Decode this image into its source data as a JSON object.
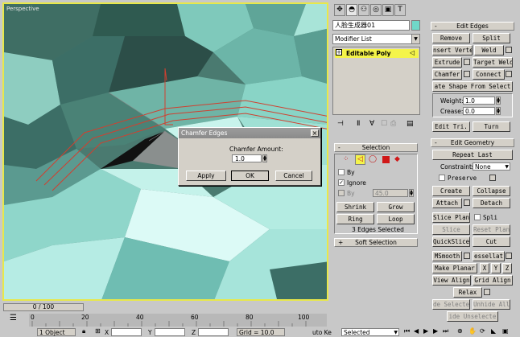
{
  "viewport": {
    "label": "Perspective"
  },
  "dialog": {
    "title": "Chamfer Edges",
    "amount_label": "Chamfer Amount:",
    "amount_value": "1.0",
    "apply": "Apply",
    "ok": "OK",
    "cancel": "Cancel"
  },
  "command_panel": {
    "object_name": "人脸生成器01",
    "modifier_list": "Modifier List",
    "stack_item": "Editable Poly"
  },
  "selection": {
    "header": "Selection",
    "by_vertex": "By",
    "ignore": "Ignore",
    "by_angle": "By",
    "angle_value": "45.0",
    "shrink": "Shrink",
    "grow": "Grow",
    "ring": "Ring",
    "loop": "Loop",
    "status": "3 Edges Selected"
  },
  "soft_selection": {
    "header": "Soft Selection"
  },
  "edit_edges": {
    "header": "Edit Edges",
    "remove": "Remove",
    "split": "Split",
    "insert_vertex": "nsert Verte",
    "weld": "Weld",
    "extrude": "Extrude",
    "target_weld": "Target Weld",
    "chamfer": "Chamfer",
    "connect": "Connect",
    "create_shape": "ate Shape From Select",
    "weight_label": "Weight:",
    "weight_value": "1.0",
    "crease_label": "Crease:",
    "crease_value": "0.0",
    "edit_tri": "Edit Tri.",
    "turn": "Turn"
  },
  "edit_geometry": {
    "header": "Edit Geometry",
    "repeat_last": "Repeat Last",
    "constraints_label": "Constraints:",
    "constraints_value": "None",
    "preserve": "Preserve",
    "create": "Create",
    "collapse": "Collapse",
    "attach": "Attach",
    "detach": "Detach",
    "slice_plane": "Slice Plane",
    "split": "Spli",
    "slice": "Slice",
    "reset_plane": "Reset Plane",
    "quickslice": "QuickSlice",
    "cut": "Cut",
    "msmooth": "MSmooth",
    "tessellate": "essellat",
    "make_planar": "Make Planar",
    "x": "X",
    "y": "Y",
    "z": "Z",
    "view_align": "View Align",
    "grid_align": "Grid Align",
    "relax": "Relax",
    "hide_selected": "de Selecte",
    "unhide_all": "Unhide All",
    "hide_unselected": "ide Unselecte"
  },
  "timeline": {
    "slider": "0 / 100",
    "ticks": [
      "0",
      "20",
      "40",
      "60",
      "80",
      "100"
    ]
  },
  "status": {
    "objects": "1 Object",
    "x_label": "X",
    "y_label": "Y",
    "z_label": "Z",
    "grid": "Grid = 10.0",
    "auto_key": "uto Ke",
    "selected": "Selected"
  }
}
